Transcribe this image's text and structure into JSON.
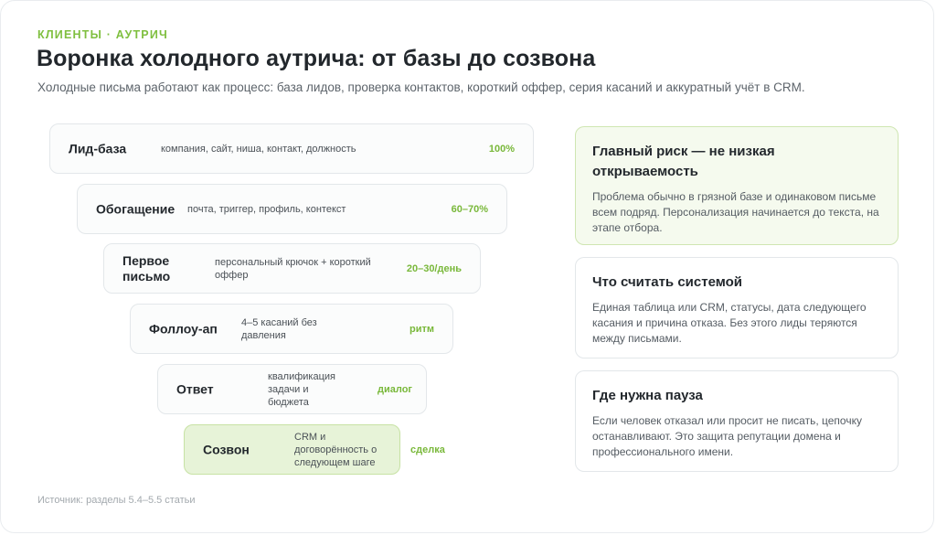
{
  "header": {
    "kicker": "КЛИЕНТЫ · АУТРИЧ",
    "title": "Воронка холодного аутрича: от базы до созвона",
    "subtitle": "Холодные письма работают как процесс: база лидов, проверка контактов, короткий оффер, серия касаний и аккуратный учёт в CRM."
  },
  "funnel": [
    {
      "name": "Лид-база",
      "desc": "компания, сайт, ниша, контакт, должность",
      "value": "100%"
    },
    {
      "name": "Обогащение",
      "desc": "почта, триггер, профиль, контекст",
      "value": "60–70%"
    },
    {
      "name": "Первое письмо",
      "desc": "персональный крючок + короткий оффер",
      "value": "20–30/день"
    },
    {
      "name": "Фоллоу-ап",
      "desc": "4–5 касаний без давления",
      "value": "ритм"
    },
    {
      "name": "Ответ",
      "desc": "квалификация задачи и бюджета",
      "value": "диалог"
    },
    {
      "name": "Созвон",
      "desc": "CRM и договорённость о следующем шаге",
      "value": "сделка"
    }
  ],
  "cards": [
    {
      "title": "Главный риск — не низкая открываемость",
      "body": "Проблема обычно в грязной базе и одинаковом письме всем подряд. Персонализация начинается до текста, на этапе отбора."
    },
    {
      "title": "Что считать системой",
      "body": "Единая таблица или CRM, статусы, дата следующего касания и причина отказа. Без этого лиды теряются между письмами."
    },
    {
      "title": "Где нужна пауза",
      "body": "Если человек отказал или просит не писать, цепочку останавливают. Это защита репутации домена и профессионального имени."
    }
  ],
  "footer": {
    "source": "Источник: разделы 5.4–5.5 статьи"
  },
  "colors": {
    "accent": "#7fbf3f",
    "final_stage_fill": "#e7f3d8",
    "highlight_card_fill": "#f5faee"
  }
}
